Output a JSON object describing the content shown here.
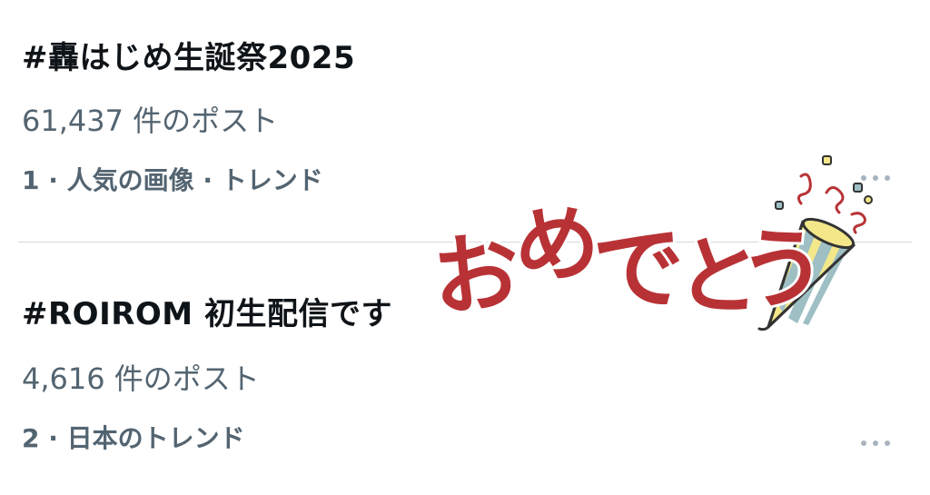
{
  "trends": [
    {
      "title": "#轟はじめ生誕祭2025",
      "count": "61,437 件のポスト",
      "meta": "1 · 人気の画像 · トレンド"
    },
    {
      "title": "#ROIROM 初生配信です",
      "count": "4,616 件のポスト",
      "meta": "2 · 日本のトレンド"
    }
  ],
  "sticker": {
    "text": "おめでとう",
    "name": "party-popper-sticker"
  },
  "icons": {
    "more": "more-horizontal-icon"
  },
  "colors": {
    "primary_text": "#0f1419",
    "secondary_text": "#536471",
    "divider": "#cfd9de",
    "sticker_red": "#b83235",
    "popper_yellow": "#f3e78a",
    "popper_blue": "#9ebfc4"
  }
}
